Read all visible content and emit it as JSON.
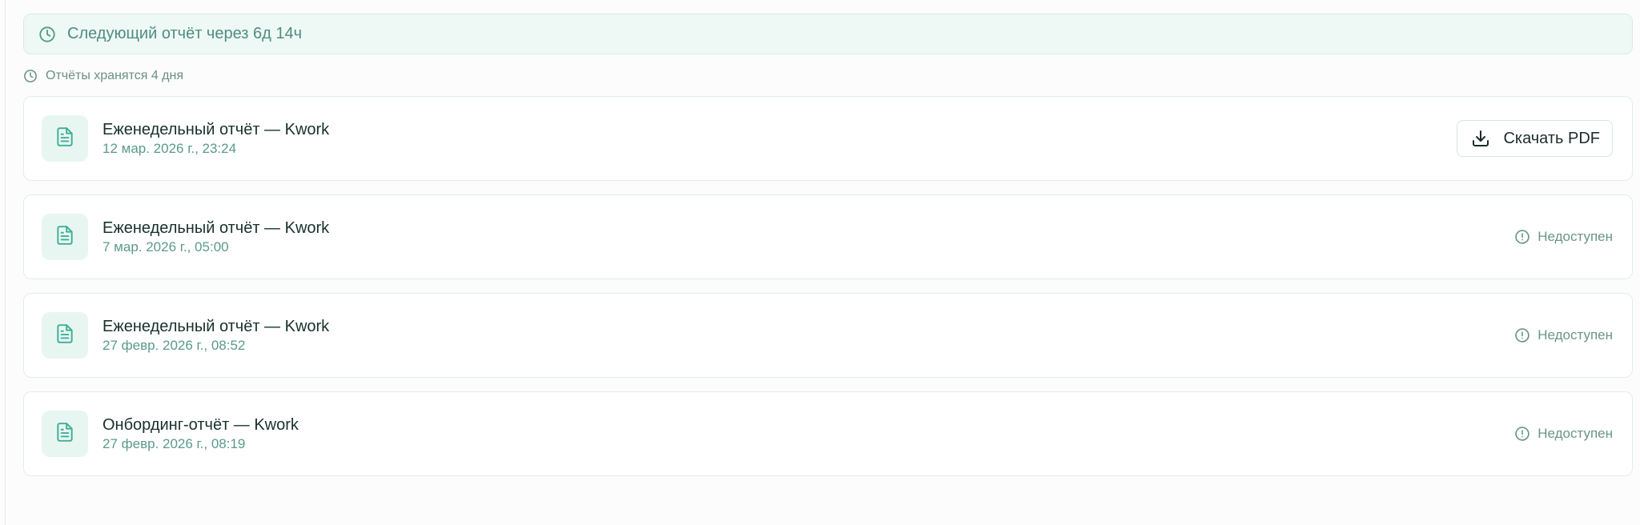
{
  "banner": {
    "icon": "clock-icon",
    "text": "Следующий отчёт через 6д 14ч"
  },
  "retention": {
    "icon": "clock-icon",
    "text": "Отчёты хранятся 4 дня"
  },
  "reports": [
    {
      "icon": "document-icon",
      "title": "Еженедельный отчёт — Kwork",
      "date": "12 мар. 2026 г., 23:24",
      "action": {
        "type": "download",
        "icon": "download-icon",
        "label": "Скачать PDF"
      }
    },
    {
      "icon": "document-icon",
      "title": "Еженедельный отчёт — Kwork",
      "date": "7 мар. 2026 г., 05:00",
      "action": {
        "type": "status",
        "icon": "alert-circle-icon",
        "label": "Недоступен"
      }
    },
    {
      "icon": "document-icon",
      "title": "Еженедельный отчёт — Kwork",
      "date": "27 февр. 2026 г., 08:52",
      "action": {
        "type": "status",
        "icon": "alert-circle-icon",
        "label": "Недоступен"
      }
    },
    {
      "icon": "document-icon",
      "title": "Онбординг-отчёт — Kwork",
      "date": "27 февр. 2026 г., 08:19",
      "action": {
        "type": "status",
        "icon": "alert-circle-icon",
        "label": "Недоступен"
      }
    }
  ],
  "colors": {
    "accent": "#3fae96",
    "banner_bg": "#eef8f4",
    "muted_text": "#6a9589"
  }
}
